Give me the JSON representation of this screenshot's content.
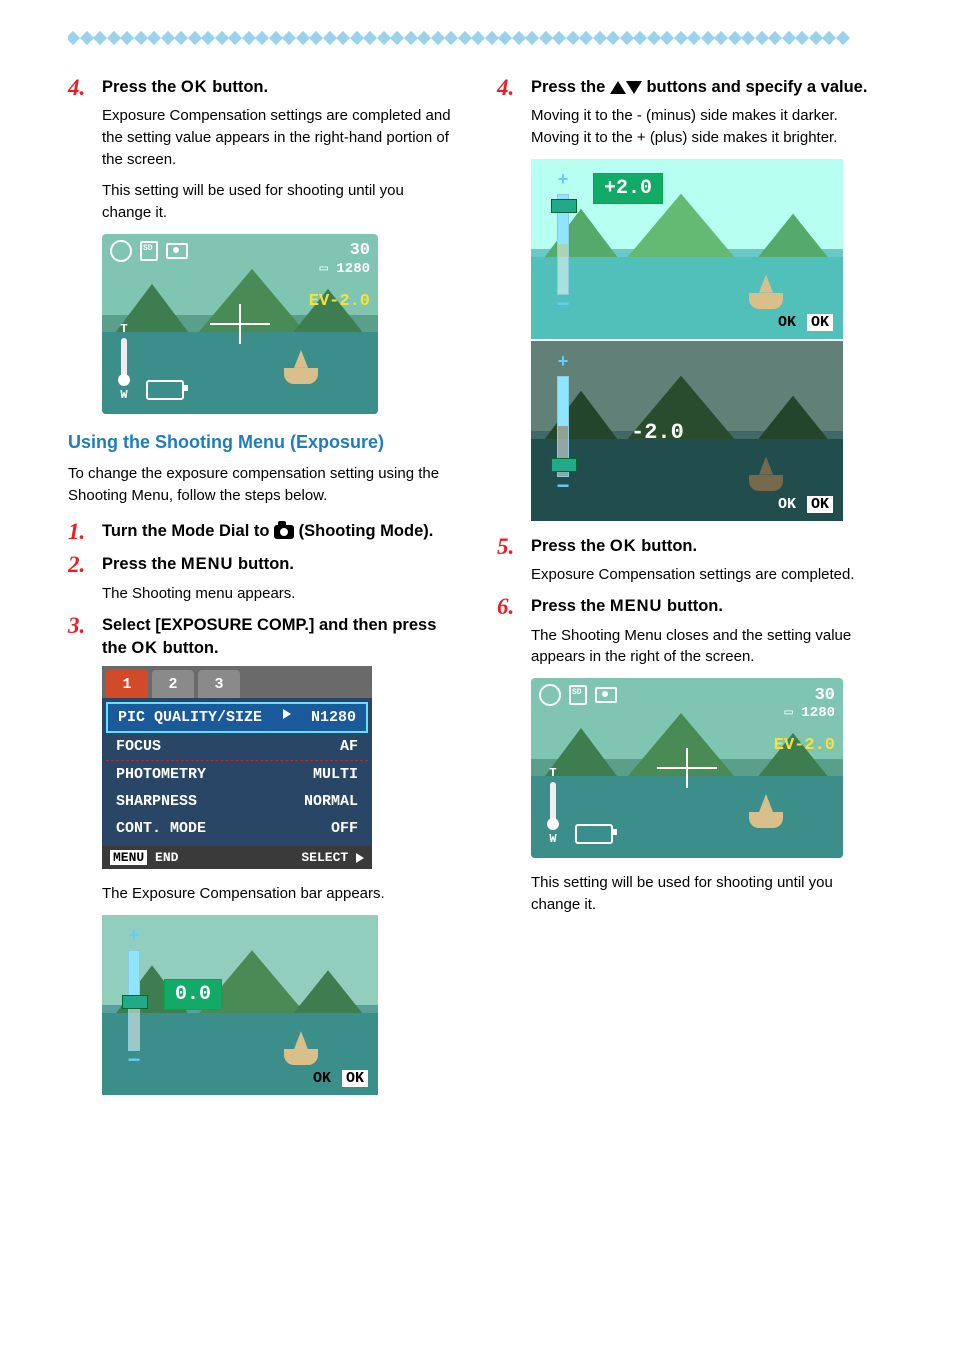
{
  "left": {
    "s4": {
      "num": "4.",
      "head_pre": "Press the ",
      "head_ok": "OK",
      "head_post": " button.",
      "p1": "Exposure Compensation settings are completed and the setting value appears in the right-hand portion of the screen.",
      "p2": "This setting will be used for shooting until you change it."
    },
    "shot1": {
      "shots": "30",
      "size": "1280",
      "ev": "EV-2.0",
      "zoom_t": "T",
      "zoom_w": "W"
    },
    "section": "Using the Shooting Menu (Exposure)",
    "intro": "To change the exposure compensation setting using the Shooting Menu, follow the steps below.",
    "s1": {
      "num": "1.",
      "head_pre": "Turn the Mode Dial to ",
      "head_post": " (Shooting Mode)."
    },
    "s2": {
      "num": "2.",
      "head_pre": "Press the ",
      "head_menu": "MENU",
      "head_post": " button.",
      "p1": "The Shooting menu appears."
    },
    "s3": {
      "num": "3.",
      "head_pre": "Select  [EXPOSURE COMP.] and then press the ",
      "head_ok": "OK",
      "head_post": " button.",
      "p1": "The Exposure Compensation bar appears."
    },
    "menu": {
      "tabs": [
        "1",
        "2",
        "3"
      ],
      "rows": [
        {
          "l": "PIC QUALITY/SIZE",
          "r": "N1280"
        },
        {
          "l": "FOCUS",
          "r": "AF"
        },
        {
          "l": "PHOTOMETRY",
          "r": "MULTI"
        },
        {
          "l": "SHARPNESS",
          "r": "NORMAL"
        },
        {
          "l": "CONT. MODE",
          "r": "OFF"
        }
      ],
      "foot_l_a": "MENU",
      "foot_l_b": "END",
      "foot_r": "SELECT"
    },
    "evshot": {
      "val": "0.0",
      "ok": "OK"
    }
  },
  "right": {
    "s4": {
      "num": "4.",
      "head_pre": "Press the ",
      "head_post": " buttons and specify a value.",
      "p1": "Moving it to the - (minus) side makes it darker. Moving it to the + (plus) side makes it brighter."
    },
    "ev_a": {
      "val": "+2.0",
      "ok": "OK"
    },
    "ev_b": {
      "val": "-2.0",
      "ok": "OK"
    },
    "s5": {
      "num": "5.",
      "head_pre": "Press the ",
      "head_ok": "OK",
      "head_post": " button.",
      "p1": "Exposure Compensation settings are completed."
    },
    "s6": {
      "num": "6.",
      "head_pre": "Press the ",
      "head_menu": "MENU",
      "head_post": " button.",
      "p1": "The Shooting Menu closes and the setting value appears in the right of the screen.",
      "p2": "This setting will be used for shooting until you change it."
    },
    "shot2": {
      "shots": "30",
      "size": "1280",
      "ev": "EV-2.0",
      "zoom_t": "T",
      "zoom_w": "W"
    }
  }
}
